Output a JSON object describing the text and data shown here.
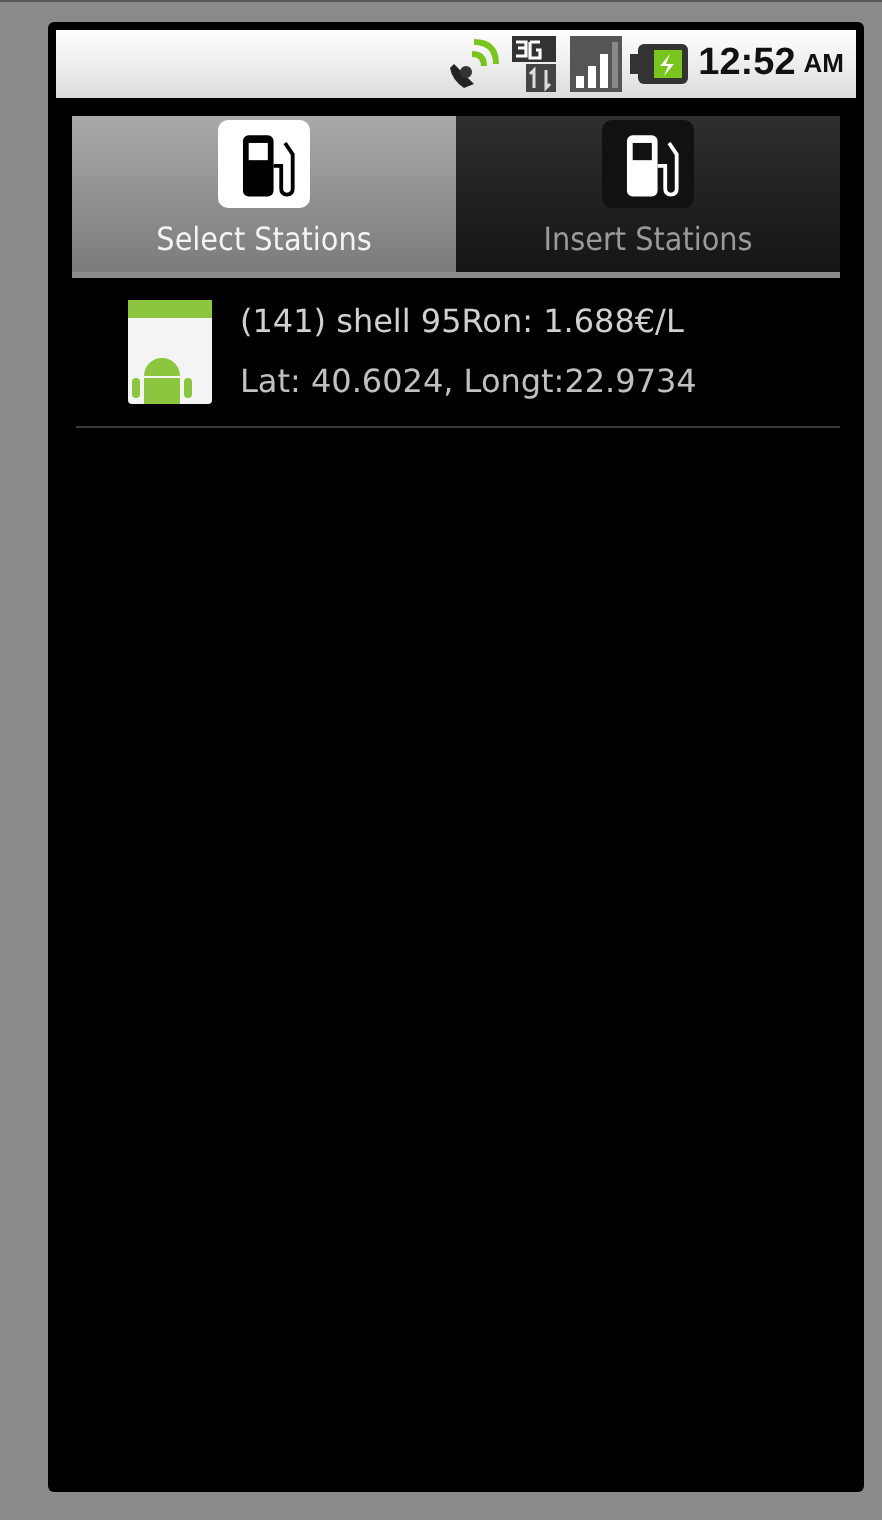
{
  "status_bar": {
    "time": "12:52",
    "meridiem": "AM"
  },
  "tabs": [
    {
      "label": "Select Stations",
      "selected": true
    },
    {
      "label": "Insert Stations",
      "selected": false
    }
  ],
  "stations": [
    {
      "title": "(141) shell 95Ron: 1.688€/L",
      "subtitle": "Lat: 40.6024, Longt:22.9734"
    }
  ]
}
